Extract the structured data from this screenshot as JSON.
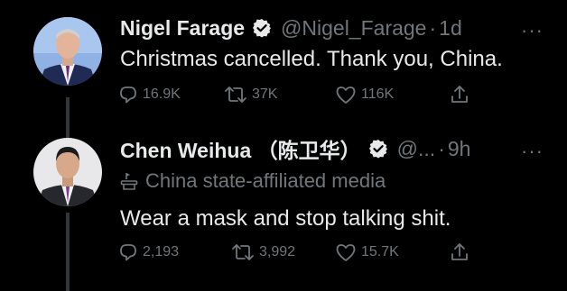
{
  "tweets": [
    {
      "name": "Nigel Farage",
      "handle": "@Nigel_Farage",
      "separator": "·",
      "time": "1d",
      "more": "···",
      "text": "Christmas cancelled. Thank you, China.",
      "replies": "16.9K",
      "retweets": "37K",
      "likes": "116K",
      "avatar_icon": "person-avatar",
      "verified_icon": "verified-badge-icon"
    },
    {
      "name": "Chen Weihua （陈卫华）",
      "handle": "@...",
      "separator": "·",
      "time": "9h",
      "more": "···",
      "affiliation": "China state-affiliated media",
      "text": "Wear a mask and stop talking shit.",
      "replies": "2,193",
      "retweets": "3,992",
      "likes": "15.7K",
      "avatar_icon": "person-avatar",
      "verified_icon": "verified-badge-icon"
    }
  ],
  "colors": {
    "background": "#000000",
    "primary_text": "#e7e9ea",
    "secondary_text": "#71767b",
    "thread_line": "#333639"
  }
}
